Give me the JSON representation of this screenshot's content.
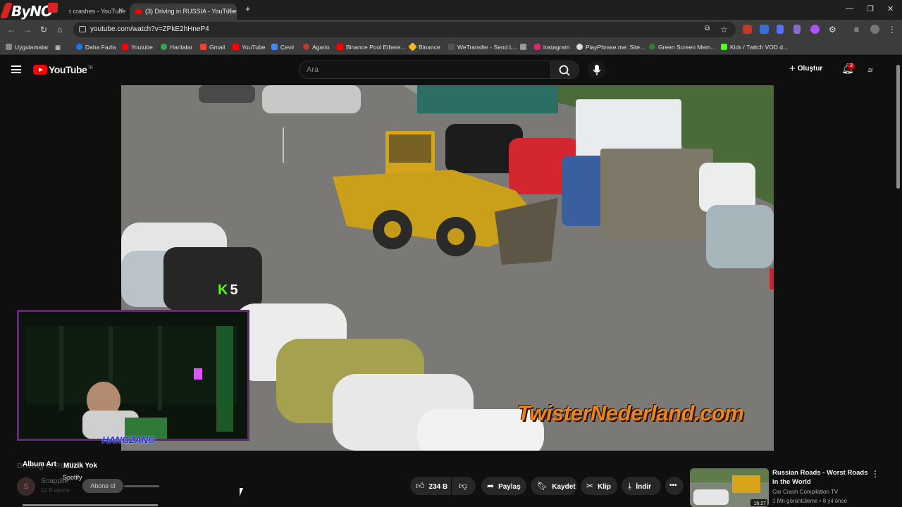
{
  "browser": {
    "overlay_logo": "ByNO",
    "tabs": [
      {
        "label": "r crashes - YouTube",
        "active": false
      },
      {
        "label": "(3) Driving in RUSSIA - YouTube",
        "active": true
      }
    ],
    "new_tab": "+",
    "url": "youtube.com/watch?v=ZPkE2hHneP4",
    "bookmarks": [
      "Uygulamalar",
      "Daha Fazla",
      "Youtube",
      "Haritalar",
      "Gmail",
      "YouTube",
      "Çevir",
      "Agario",
      "Binance Pool Ethere...",
      "Binance",
      "WeTransfer - Send L...",
      "instagram",
      "PlayPhrase.me: Site...",
      "Green Screen Mem...",
      "Kick / Twitch VOD d..."
    ]
  },
  "youtube": {
    "logo": "YouTube",
    "logo_region": "TR",
    "search_placeholder": "Ara",
    "create_label": "Oluştur",
    "notification_count": "3"
  },
  "video": {
    "watermark": "TwisterNederland.com",
    "kick_count": "5",
    "webcam_label": "HANGZANG"
  },
  "below_video": {
    "title_partial": "Driving in RUSSIA",
    "album_art": "Album Art",
    "music_status": "Müzik Yok",
    "music_source": "Spotify",
    "channel_name": "Snapplik",
    "channel_initial": "S",
    "subscriber_count": "12 B abone",
    "subscribe_label": "Abone ol",
    "like_count": "234 B",
    "share_label": "Paylaş",
    "save_label": "Kaydet",
    "clip_label": "Klip",
    "download_label": "İndir"
  },
  "recommended": {
    "title": "Russian Roads - Worst Roads in the World",
    "channel": "Car Crash Compilation TV",
    "meta": "1 Mn görüntüleme • 8 yıl önce",
    "duration": "16:27"
  },
  "colors": {
    "yt_red": "#ff0000",
    "watermark_orange": "#e98521",
    "kick_green": "#53fc18",
    "cam_border": "#5d2b6e"
  }
}
